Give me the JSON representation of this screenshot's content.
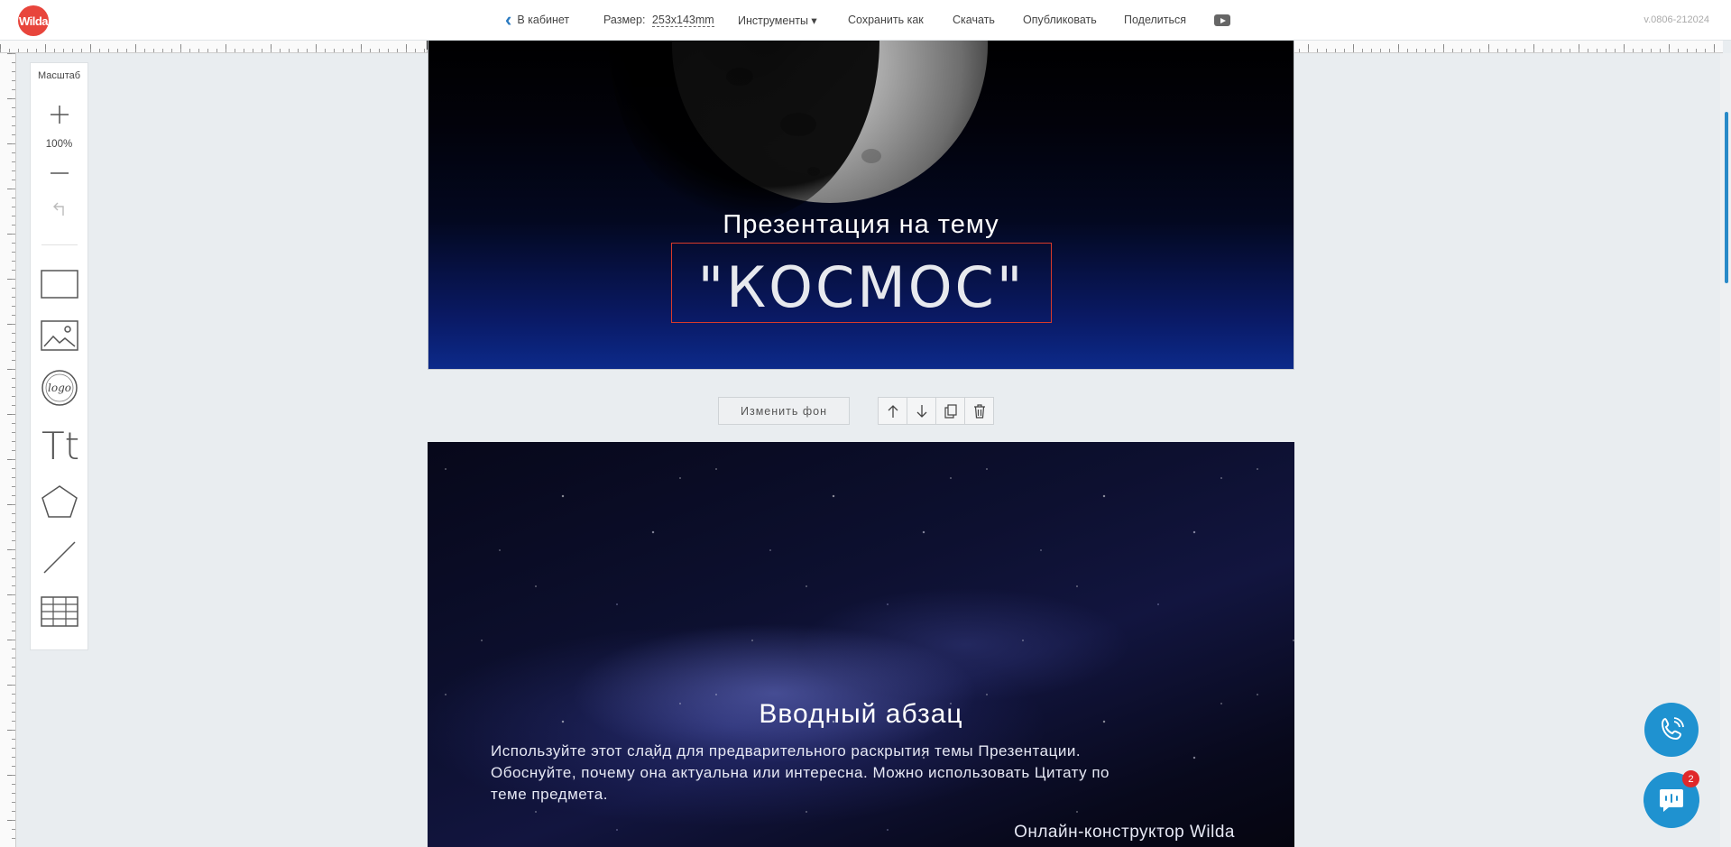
{
  "app": {
    "logo_text": "Wilda",
    "version": "v.0806-212024"
  },
  "topbar": {
    "back_label": "В кабинет",
    "size_label": "Размер:",
    "size_value": "253x143mm",
    "tools_label": "Инструменты ▾",
    "save_as_label": "Сохранить как",
    "download_label": "Скачать",
    "publish_label": "Опубликовать",
    "share_label": "Поделиться"
  },
  "toolpanel": {
    "scale_label": "Масштаб",
    "zoom_value": "100%",
    "logo_icon_text": "logo",
    "text_icon_text": "Tt"
  },
  "slide1": {
    "subtitle": "Презентация на тему",
    "title": "\"КОСМОС\""
  },
  "slide_controls": {
    "change_bg_label": "Изменить фон"
  },
  "slide2": {
    "title": "Вводный абзац",
    "body": "Используйте этот слайд для предварительного раскрытия темы Презентации. Обоснуйте, почему она актуальна или интересна. Можно использовать Цитату по теме предмета.",
    "footer": "Онлайн-конструктор Wilda"
  },
  "chat": {
    "badge_count": "2"
  },
  "colors": {
    "brand": "#e8453c",
    "accent": "#1f92d0",
    "selection": "#d83a2a"
  }
}
